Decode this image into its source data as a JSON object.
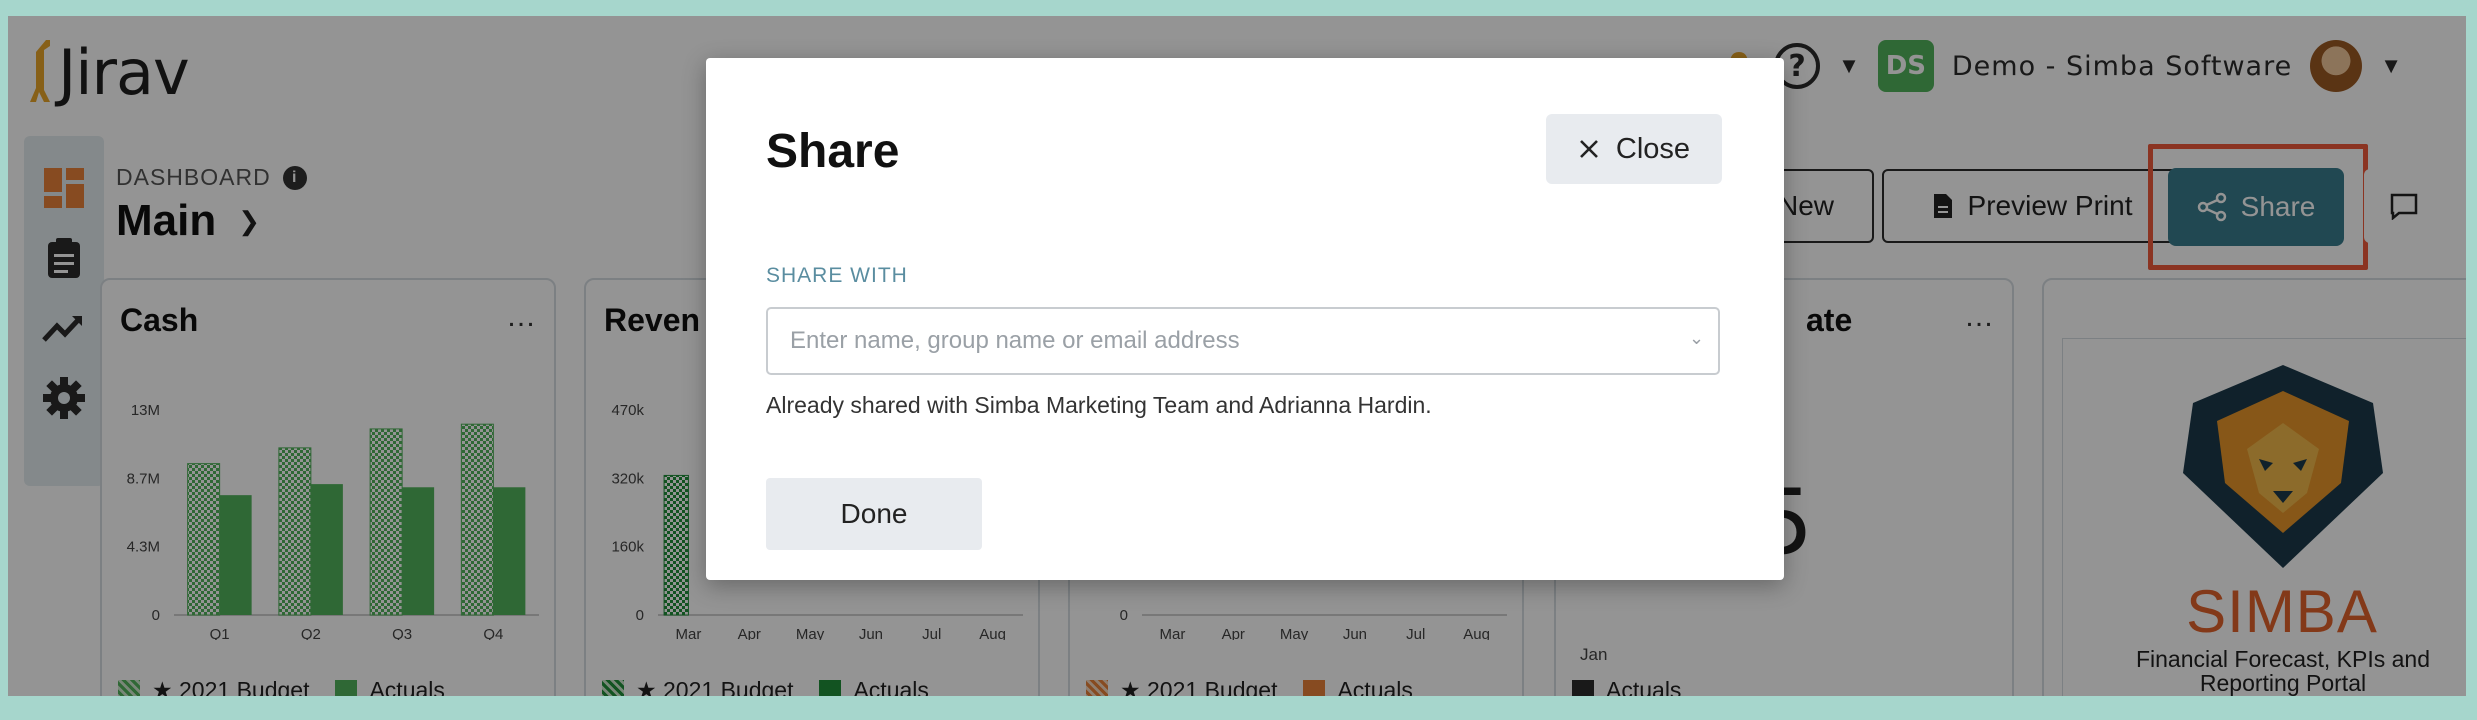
{
  "app": {
    "brand": "Jirav"
  },
  "header": {
    "user_initials": "DS",
    "user_name": "Demo - Simba Software",
    "help_glyph": "?"
  },
  "dashboard": {
    "section_label": "DASHBOARD",
    "title": "Main",
    "info_glyph": "i"
  },
  "toolbar": {
    "new_label": "New",
    "preview_print_label": "Preview Print",
    "share_label": "Share"
  },
  "cards": {
    "cash": {
      "title": "Cash",
      "chart_data": {
        "type": "bar",
        "categories": [
          "Q1",
          "Q2",
          "Q3",
          "Q4"
        ],
        "yticks": [
          "13M",
          "8.7M",
          "4.3M",
          "0"
        ],
        "ylim": [
          0,
          13
        ],
        "series": [
          {
            "name": "★ 2021 Budget",
            "values": [
              9.6,
              10.6,
              11.8,
              12.1
            ]
          },
          {
            "name": "Actuals",
            "values": [
              7.6,
              8.3,
              8.1,
              8.1
            ]
          }
        ]
      },
      "legend": {
        "budget": "★ 2021 Budget",
        "actuals": "Actuals"
      },
      "colors": {
        "bar": "#52b35c"
      }
    },
    "revenue": {
      "title": "Reven",
      "chart_data": {
        "type": "bar",
        "categories": [
          "Mar",
          "Apr",
          "May",
          "Jun",
          "Jul",
          "Aug"
        ],
        "yticks": [
          "470k",
          "320k",
          "160k",
          "0"
        ],
        "ylim": [
          0,
          470
        ],
        "series": [
          {
            "name": "★ 2021 Budget",
            "values": [
              320,
              0,
              0,
              0,
              0,
              0
            ]
          },
          {
            "name": "Actuals",
            "values": [
              0,
              0,
              0,
              0,
              0,
              0
            ]
          }
        ]
      },
      "legend": {
        "budget": "★ 2021 Budget",
        "actuals": "Actuals"
      },
      "colors": {
        "bar": "#1f8f3a"
      }
    },
    "expenses": {
      "chart_data": {
        "type": "bar",
        "categories": [
          "Mar",
          "Apr",
          "May",
          "Jun",
          "Jul",
          "Aug"
        ],
        "yticks": [
          "0"
        ],
        "series": [
          {
            "name": "★ 2021 Budget",
            "values": []
          },
          {
            "name": "Actuals",
            "values": []
          }
        ]
      },
      "legend": {
        "budget": "★ 2021 Budget",
        "actuals": "Actuals"
      },
      "colors": {
        "bar": "#e8823a"
      }
    },
    "rate": {
      "title_partial": "ate",
      "big_number_partial": "5",
      "x_label": "Jan",
      "legend": {
        "actuals": "Actuals"
      }
    },
    "simba": {
      "word": "SIMBA",
      "tagline": "Financial Forecast, KPIs and Reporting Portal"
    }
  },
  "modal": {
    "title": "Share",
    "close_label": "Close",
    "share_with_label": "SHARE WITH",
    "input_placeholder": "Enter name, group name or email address",
    "already_shared": "Already shared with Simba Marketing Team and Adrianna Hardin.",
    "done_label": "Done"
  },
  "colors": {
    "border_frame": "#a6d6cc",
    "accent": "#3a7c8e",
    "highlight": "#ef5a3c",
    "logo_orange": "#e8a52a",
    "sidebar_orange": "#e8823a",
    "user_badge": "#52b35c"
  }
}
